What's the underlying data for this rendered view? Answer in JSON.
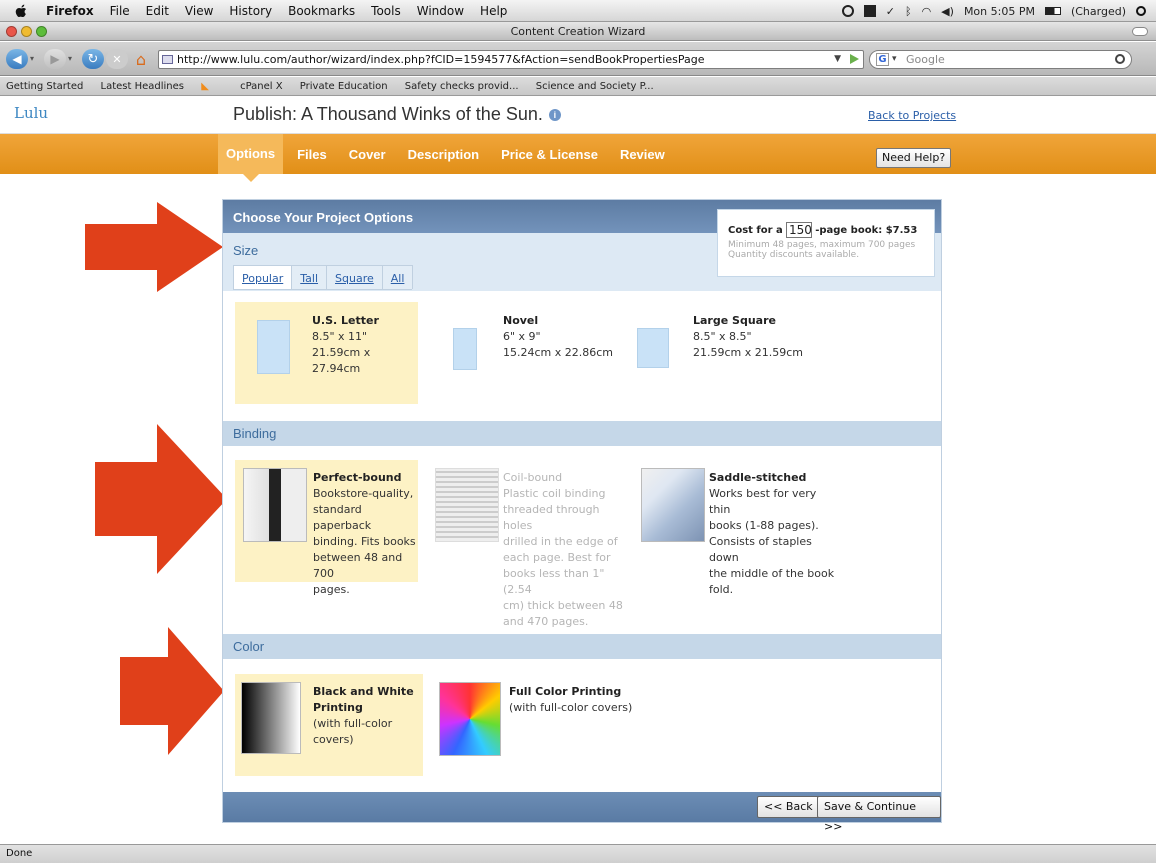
{
  "menubar": {
    "app": "Firefox",
    "items": [
      "File",
      "Edit",
      "View",
      "History",
      "Bookmarks",
      "Tools",
      "Window",
      "Help"
    ],
    "clock": "Mon 5:05 PM",
    "battery": "(Charged)"
  },
  "window": {
    "title": "Content Creation Wizard"
  },
  "nav": {
    "url": "http://www.lulu.com/author/wizard/index.php?fCID=1594577&fAction=sendBookPropertiesPage",
    "search_placeholder": "Google"
  },
  "bookmarks": [
    "Getting Started",
    "Latest Headlines",
    "cPanel X",
    "Private Education",
    "Safety checks provid...",
    "Science and Society P..."
  ],
  "lulu": {
    "logo": "Lulu",
    "page_title": "Publish: A Thousand Winks of the Sun.",
    "back_link": "Back to Projects",
    "tabs": [
      "Options",
      "Files",
      "Cover",
      "Description",
      "Price & License",
      "Review"
    ],
    "help": "Need Help?"
  },
  "panel": {
    "header": "Choose Your Project Options",
    "cost": {
      "prefix": "Cost for a",
      "pages": "150",
      "suffix": "-page book: $7.53",
      "line1": "Minimum 48 pages, maximum 700 pages",
      "line2": "Quantity discounts available."
    },
    "size": {
      "title": "Size",
      "tabs": [
        "Popular",
        "Tall",
        "Square",
        "All"
      ],
      "options": [
        {
          "name": "U.S. Letter",
          "dim1": "8.5\" x 11\"",
          "dim2": "21.59cm x 27.94cm"
        },
        {
          "name": "Novel",
          "dim1": "6\" x 9\"",
          "dim2": "15.24cm x 22.86cm"
        },
        {
          "name": "Large Square",
          "dim1": "8.5\" x 8.5\"",
          "dim2": "21.59cm x 21.59cm"
        }
      ]
    },
    "binding": {
      "title": "Binding",
      "options": [
        {
          "name": "Perfect-bound",
          "desc": [
            "Bookstore-quality,",
            "standard paperback",
            "binding. Fits books",
            "between 48 and 700",
            "pages."
          ]
        },
        {
          "name": "Coil-bound",
          "desc": [
            "Plastic coil binding",
            "threaded through holes",
            "drilled in the edge of",
            "each page. Best for",
            "books less than 1\" (2.54",
            "cm) thick between 48",
            "and 470 pages."
          ]
        },
        {
          "name": "Saddle-stitched",
          "desc": [
            "Works best for very thin",
            "books (1-88 pages).",
            "Consists of staples down",
            "the middle of the book",
            "fold."
          ]
        }
      ]
    },
    "color": {
      "title": "Color",
      "options": [
        {
          "name1": "Black and White",
          "name2": "Printing",
          "desc": "(with full-color covers)"
        },
        {
          "name1": "Full Color Printing",
          "name2": "",
          "desc": "(with full-color covers)"
        }
      ]
    },
    "buttons": {
      "back": "<< Back",
      "save": "Save & Continue >>"
    }
  },
  "status": "Done",
  "colors": {
    "accent_orange": "#e8961f",
    "annotation_arrow": "#e0401a",
    "panel_header": "#6585ad",
    "selected_option": "#fdf2c5"
  }
}
